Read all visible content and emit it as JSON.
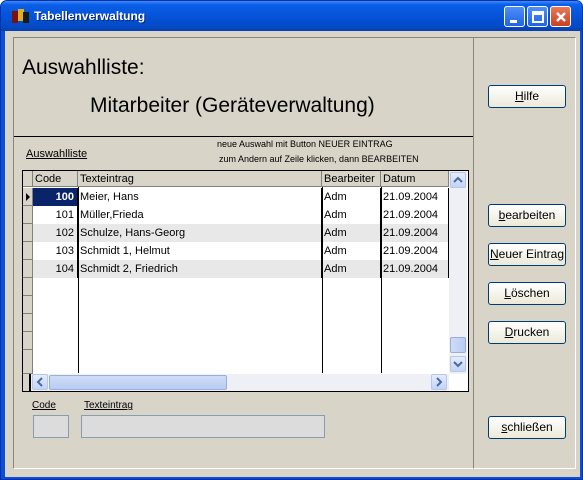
{
  "window": {
    "title": "Tabellenverwaltung"
  },
  "header": {
    "title": "Auswahlliste:",
    "subtitle": "Mitarbeiter (Geräteverwaltung)"
  },
  "list_section": {
    "label": "Auswahlliste",
    "hint_line1": "neue Auswahl mit Button NEUER EINTRAG",
    "hint_line2": "zum Andern auf Zeile klicken, dann BEARBEITEN"
  },
  "table": {
    "columns": [
      "Code",
      "Texteintrag",
      "Bearbeiter",
      "Datum"
    ],
    "rows": [
      {
        "code": "100",
        "text": "Meier, Hans",
        "editor": "Adm",
        "date": "21.09.2004"
      },
      {
        "code": "101",
        "text": "Müller,Frieda",
        "editor": "Adm",
        "date": "21.09.2004"
      },
      {
        "code": "102",
        "text": "Schulze, Hans-Georg",
        "editor": "Adm",
        "date": "21.09.2004"
      },
      {
        "code": "103",
        "text": "Schmidt 1, Helmut",
        "editor": "Adm",
        "date": "21.09.2004"
      },
      {
        "code": "104",
        "text": "Schmidt 2, Friedrich",
        "editor": "Adm",
        "date": "21.09.2004"
      }
    ],
    "selected_row": 0
  },
  "form": {
    "code_label": "Code",
    "text_label": "Texteintrag",
    "code_value": "",
    "text_value": ""
  },
  "buttons": {
    "help_first": "H",
    "help_rest": "ilfe",
    "edit_first": "b",
    "edit_rest": "earbeiten",
    "new_first": "N",
    "new_rest": "euer Eintrag",
    "delete_first": "L",
    "delete_rest": "öschen",
    "print_first": "D",
    "print_rest": "rucken",
    "close_first": "s",
    "close_rest": "chließen"
  },
  "colors": {
    "titlebar": "#0553d8",
    "selection": "#0a246a",
    "dialog": "#d8d4c8"
  }
}
